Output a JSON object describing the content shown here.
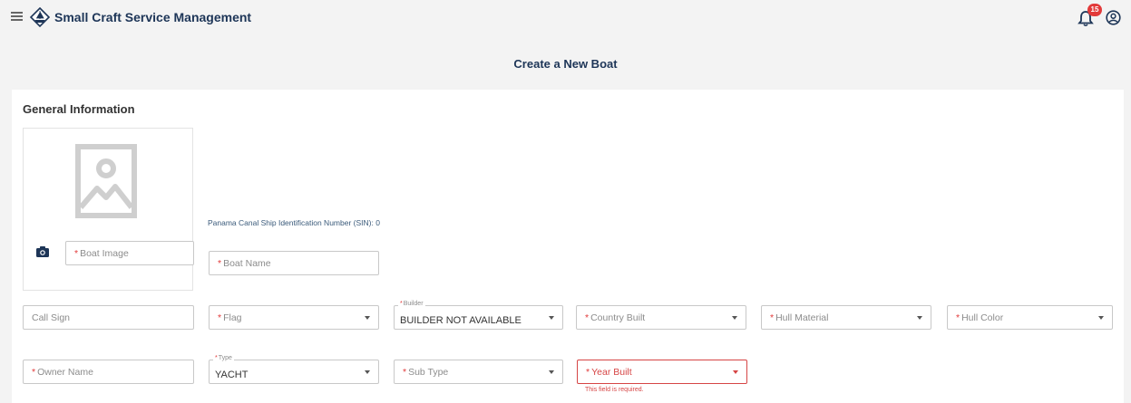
{
  "header": {
    "app_title": "Small Craft Service Management",
    "notification_count": "15",
    "accent_color": "#1d3557",
    "badge_color": "#e23a3a"
  },
  "page": {
    "title": "Create a New Boat"
  },
  "form": {
    "section_title": "General Information",
    "boat_image": {
      "placeholder": "Boat Image",
      "required": "*"
    },
    "sin_label": "Panama Canal Ship Identification Number (SIN): 0",
    "boat_name": {
      "placeholder": "Boat Name",
      "required": "*"
    },
    "call_sign": {
      "placeholder": "Call Sign"
    },
    "flag": {
      "placeholder": "Flag",
      "required": "*"
    },
    "builder": {
      "label": "Builder",
      "required": "*",
      "value": "BUILDER NOT AVAILABLE"
    },
    "country_built": {
      "placeholder": "Country Built",
      "required": "*"
    },
    "hull_material": {
      "placeholder": "Hull Material",
      "required": "*"
    },
    "hull_color": {
      "placeholder": "Hull Color",
      "required": "*"
    },
    "owner_name": {
      "placeholder": "Owner Name",
      "required": "*"
    },
    "type": {
      "label": "Type",
      "required": "*",
      "value": "YACHT"
    },
    "sub_type": {
      "placeholder": "Sub Type",
      "required": "*"
    },
    "year_built": {
      "placeholder": "Year Built",
      "required": "*",
      "error": "This field is required."
    }
  }
}
